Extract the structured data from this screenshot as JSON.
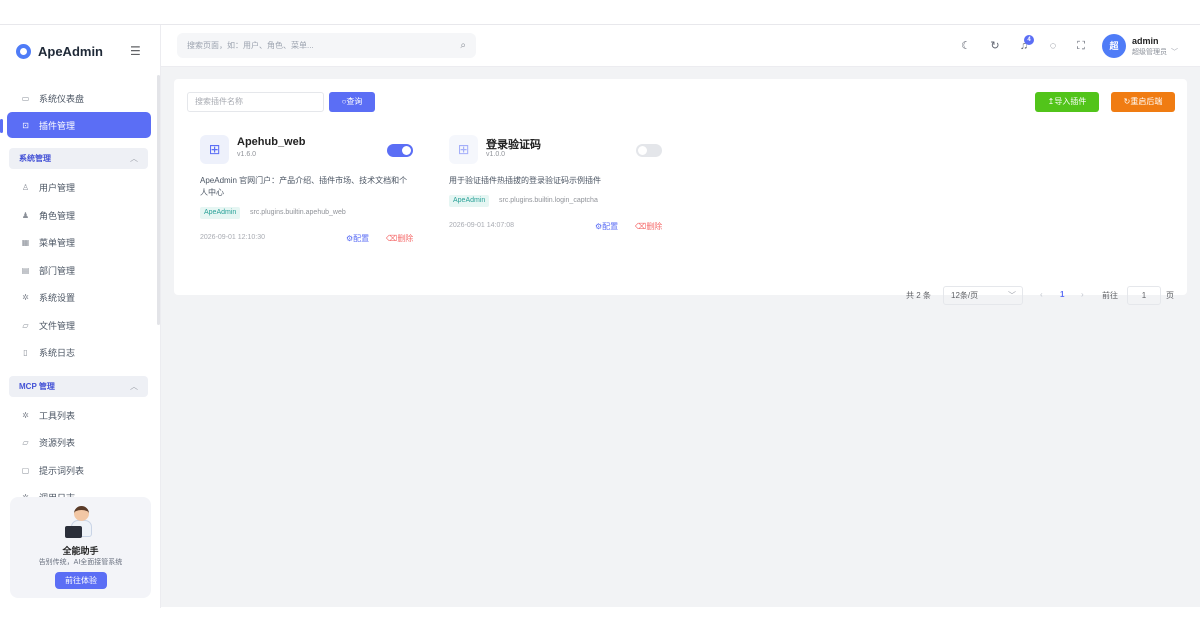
{
  "brand": {
    "name": "ApeAdmin"
  },
  "search": {
    "placeholder": "搜索页面，如：用户、角色、菜单..."
  },
  "header": {
    "notification_count": "4",
    "user": {
      "avatar_text": "超",
      "name": "admin",
      "role": "超级管理员"
    }
  },
  "sidebar": {
    "items": [
      {
        "label": "系统仪表盘",
        "icon": "monitor-icon"
      },
      {
        "label": "插件管理",
        "icon": "plugin-icon",
        "active": true
      }
    ],
    "groups": [
      {
        "label": "系统管理",
        "items": [
          {
            "label": "用户管理",
            "icon": "user-icon"
          },
          {
            "label": "角色管理",
            "icon": "user-filled-icon"
          },
          {
            "label": "菜单管理",
            "icon": "grid-icon"
          },
          {
            "label": "部门管理",
            "icon": "building-icon"
          },
          {
            "label": "系统设置",
            "icon": "gear-icon"
          },
          {
            "label": "文件管理",
            "icon": "folder-icon"
          },
          {
            "label": "系统日志",
            "icon": "document-icon"
          }
        ]
      },
      {
        "label": "MCP 管理",
        "items": [
          {
            "label": "工具列表",
            "icon": "gear-icon"
          },
          {
            "label": "资源列表",
            "icon": "folder-icon"
          },
          {
            "label": "提示词列表",
            "icon": "chat-icon"
          },
          {
            "label": "调用日志",
            "icon": "gear-icon"
          }
        ]
      }
    ],
    "assistant": {
      "title": "全能助手",
      "subtitle": "告别传统，AI全面接管系统",
      "button": "前往体验"
    }
  },
  "toolbar": {
    "search_placeholder": "搜索插件名称",
    "query_label": "查询",
    "import_label": "导入插件",
    "restart_label": "重启后端"
  },
  "plugins": [
    {
      "name": "Apehub_web",
      "version": "v1.6.0",
      "enabled": true,
      "description": "ApeAdmin 官网门户：产品介绍、插件市场、技术文档和个人中心",
      "tag": "ApeAdmin",
      "path": "src.plugins.builtin.apehub_web",
      "time": "2026-09-01 12:10:30",
      "config_label": "配置",
      "delete_label": "删除"
    },
    {
      "name": "登录验证码",
      "version": "v1.0.0",
      "enabled": false,
      "description": "用于验证插件热插拔的登录验证码示例插件",
      "tag": "ApeAdmin",
      "path": "src.plugins.builtin.login_captcha",
      "time": "2026-09-01 14:07:08",
      "config_label": "配置",
      "delete_label": "删除"
    }
  ],
  "pagination": {
    "total": "共 2 条",
    "page_size": "12条/页",
    "current_page": "1",
    "goto_label": "前往",
    "goto_value": "1",
    "page_unit": "页"
  },
  "colors": {
    "primary": "#5b6ef5",
    "success": "#52c41a",
    "warning": "#f07c12",
    "danger": "#f56c6c"
  }
}
